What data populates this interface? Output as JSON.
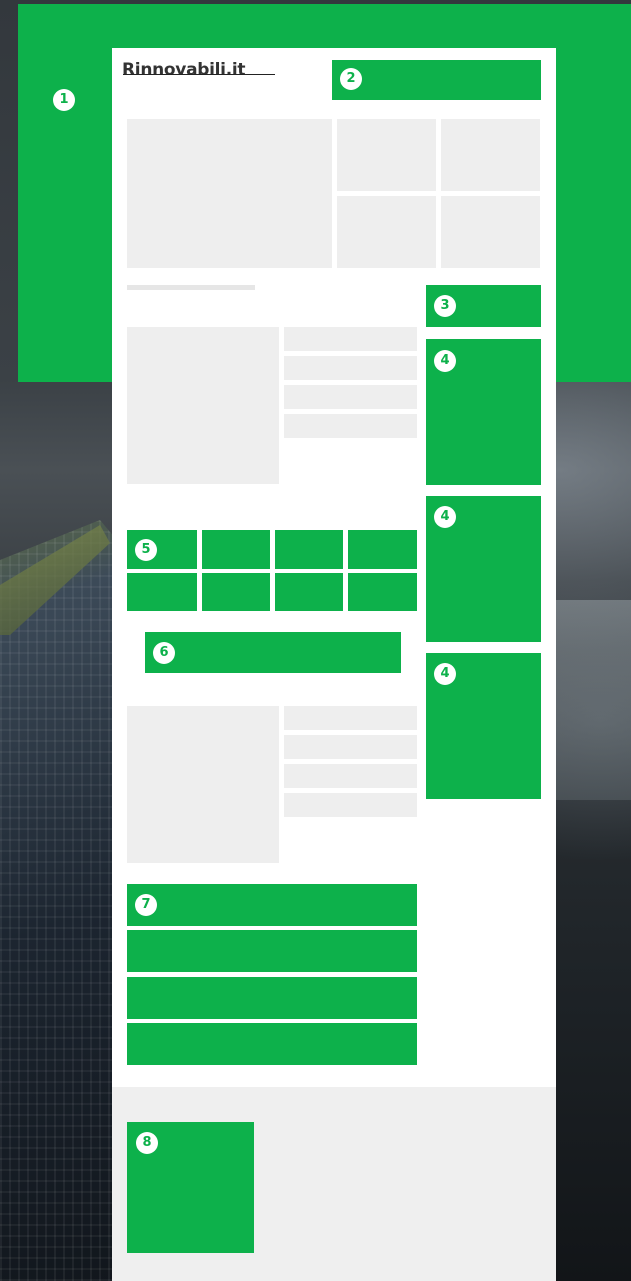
{
  "logo_text": "Rinnovabili.it",
  "accent_color": "#0db14b",
  "badges": {
    "b1": "1",
    "b2": "2",
    "b3": "3",
    "b4a": "4",
    "b4b": "4",
    "b4c": "4",
    "b5": "5",
    "b6": "6",
    "b7": "7",
    "b8": "8"
  }
}
